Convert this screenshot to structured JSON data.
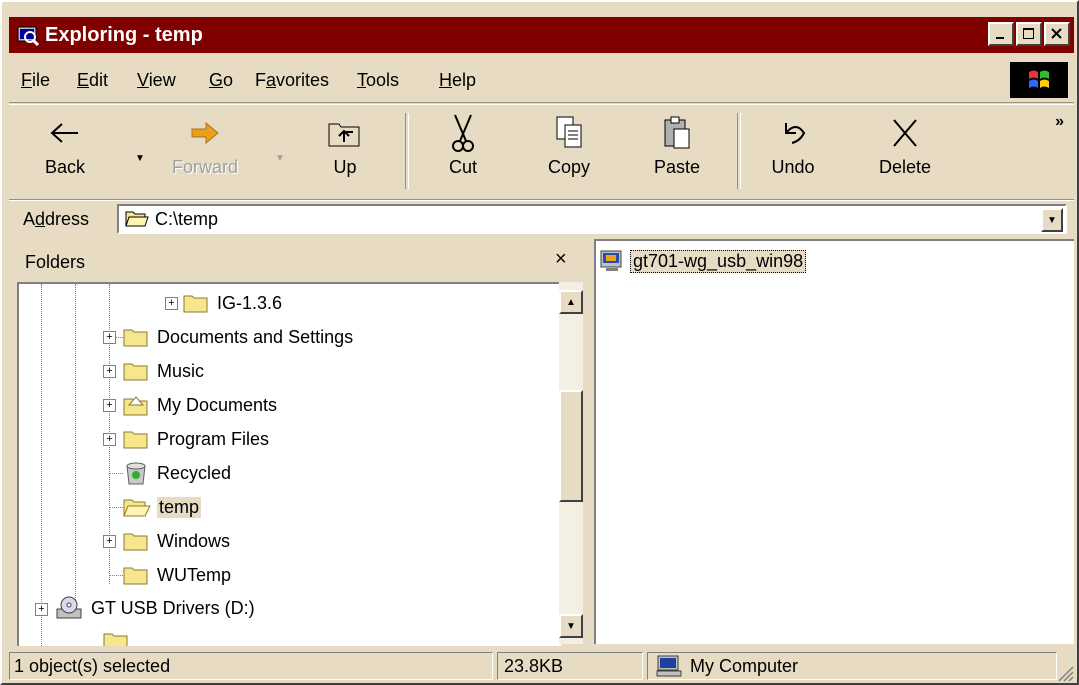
{
  "window": {
    "title": "Exploring - temp"
  },
  "menu": [
    "File",
    "Edit",
    "View",
    "Go",
    "Favorites",
    "Tools",
    "Help"
  ],
  "menu_underline": [
    "F",
    "E",
    "V",
    "G",
    "a",
    "T",
    "H"
  ],
  "toolbar": {
    "back": "Back",
    "forward": "Forward",
    "up": "Up",
    "cut": "Cut",
    "copy": "Copy",
    "paste": "Paste",
    "undo": "Undo",
    "delete": "Delete",
    "more": "»"
  },
  "address": {
    "label_pre": "A",
    "label_u": "d",
    "label_post": "dress",
    "value": "C:\\temp"
  },
  "folders": {
    "title": "Folders",
    "close": "×",
    "items": [
      {
        "label": "IG-1.3.6"
      },
      {
        "label": "Documents and Settings"
      },
      {
        "label": "Music"
      },
      {
        "label": "My Documents"
      },
      {
        "label": "Program Files"
      },
      {
        "label": "Recycled"
      },
      {
        "label": "temp"
      },
      {
        "label": "Windows"
      },
      {
        "label": "WUTemp"
      },
      {
        "label": "GT USB Drivers (D:)"
      }
    ]
  },
  "files": [
    {
      "name": "gt701-wg_usb_win98"
    }
  ],
  "status": {
    "selected": "1 object(s) selected",
    "size": "23.8KB",
    "location": "My Computer"
  },
  "colors": {
    "titlebar": "#800000",
    "chrome": "#e7dcc3",
    "folder": "#f7e78c"
  }
}
